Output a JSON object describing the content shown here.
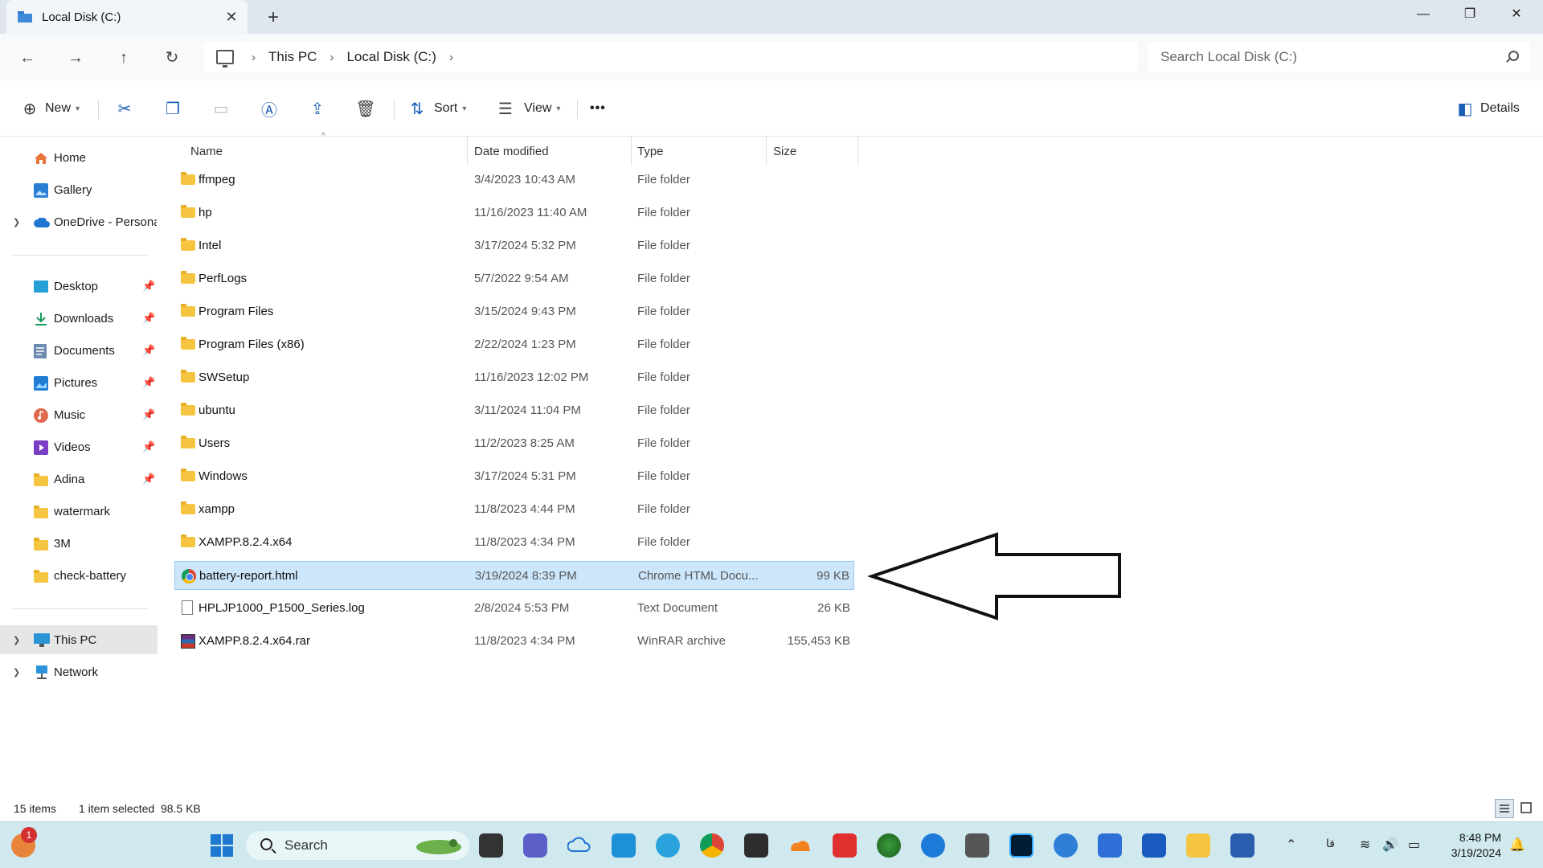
{
  "window": {
    "tab_title": "Local Disk (C:)",
    "tab_close": "✕",
    "new_tab": "+",
    "minimize": "—",
    "restore": "❐",
    "close": "✕"
  },
  "navigation": {
    "back": "←",
    "forward": "→",
    "up": "↑",
    "refresh": "↻",
    "breadcrumb": [
      "This PC",
      "Local Disk (C:)"
    ],
    "breadcrumb_sep": "›",
    "search_placeholder": "Search Local Disk (C:)"
  },
  "toolbar": {
    "new_label": "New",
    "sort_label": "Sort",
    "view_label": "View",
    "more_label": "•••",
    "details_label": "Details",
    "icons": {
      "new": "plus-circle-icon",
      "cut": "scissors-icon",
      "copy": "copy-icon",
      "paste": "paste-icon",
      "rename": "rename-icon",
      "share": "share-icon",
      "delete": "trash-icon"
    }
  },
  "sidebar": {
    "top_items": [
      {
        "label": "Home",
        "icon": "home-icon"
      },
      {
        "label": "Gallery",
        "icon": "gallery-icon"
      },
      {
        "label": "OneDrive - Persona",
        "icon": "cloud-icon"
      }
    ],
    "quick_access": [
      {
        "label": "Desktop",
        "icon": "desktop-icon",
        "pinned": true
      },
      {
        "label": "Downloads",
        "icon": "download-icon",
        "pinned": true
      },
      {
        "label": "Documents",
        "icon": "documents-icon",
        "pinned": true
      },
      {
        "label": "Pictures",
        "icon": "pictures-icon",
        "pinned": true
      },
      {
        "label": "Music",
        "icon": "music-icon",
        "pinned": true
      },
      {
        "label": "Videos",
        "icon": "videos-icon",
        "pinned": true
      },
      {
        "label": "Adina",
        "icon": "folder-icon",
        "pinned": true
      },
      {
        "label": "watermark",
        "icon": "folder-icon",
        "pinned": false
      },
      {
        "label": "3M",
        "icon": "folder-icon",
        "pinned": false
      },
      {
        "label": "check-battery",
        "icon": "folder-icon",
        "pinned": false
      }
    ],
    "bottom_items": [
      {
        "label": "This PC",
        "icon": "pc-icon",
        "selected": true
      },
      {
        "label": "Network",
        "icon": "network-icon",
        "selected": false
      }
    ]
  },
  "filelist": {
    "columns": [
      "Name",
      "Date modified",
      "Type",
      "Size"
    ],
    "rows": [
      {
        "name": "ffmpeg",
        "date": "3/4/2023 10:43 AM",
        "type": "File folder",
        "size": "",
        "kind": "folder"
      },
      {
        "name": "hp",
        "date": "11/16/2023 11:40 AM",
        "type": "File folder",
        "size": "",
        "kind": "folder"
      },
      {
        "name": "Intel",
        "date": "3/17/2024 5:32 PM",
        "type": "File folder",
        "size": "",
        "kind": "folder"
      },
      {
        "name": "PerfLogs",
        "date": "5/7/2022 9:54 AM",
        "type": "File folder",
        "size": "",
        "kind": "folder"
      },
      {
        "name": "Program Files",
        "date": "3/15/2024 9:43 PM",
        "type": "File folder",
        "size": "",
        "kind": "folder"
      },
      {
        "name": "Program Files (x86)",
        "date": "2/22/2024 1:23 PM",
        "type": "File folder",
        "size": "",
        "kind": "folder"
      },
      {
        "name": "SWSetup",
        "date": "11/16/2023 12:02 PM",
        "type": "File folder",
        "size": "",
        "kind": "folder"
      },
      {
        "name": "ubuntu",
        "date": "3/11/2024 11:04 PM",
        "type": "File folder",
        "size": "",
        "kind": "folder"
      },
      {
        "name": "Users",
        "date": "11/2/2023 8:25 AM",
        "type": "File folder",
        "size": "",
        "kind": "folder"
      },
      {
        "name": "Windows",
        "date": "3/17/2024 5:31 PM",
        "type": "File folder",
        "size": "",
        "kind": "folder"
      },
      {
        "name": "xampp",
        "date": "11/8/2023 4:44 PM",
        "type": "File folder",
        "size": "",
        "kind": "folder"
      },
      {
        "name": "XAMPP.8.2.4.x64",
        "date": "11/8/2023 4:34 PM",
        "type": "File folder",
        "size": "",
        "kind": "folder"
      },
      {
        "name": "battery-report.html",
        "date": "3/19/2024 8:39 PM",
        "type": "Chrome HTML Docu...",
        "size": "99 KB",
        "kind": "chrome",
        "selected": true
      },
      {
        "name": "HPLJP1000_P1500_Series.log",
        "date": "2/8/2024 5:53 PM",
        "type": "Text Document",
        "size": "26 KB",
        "kind": "text"
      },
      {
        "name": "XAMPP.8.2.4.x64.rar",
        "date": "11/8/2023 4:34 PM",
        "type": "WinRAR archive",
        "size": "155,453 KB",
        "kind": "rar"
      }
    ]
  },
  "status": {
    "count": "15 items",
    "selection": "1 item selected  98.5 KB"
  },
  "taskbar": {
    "search_label": "Search",
    "notification_badge": "1",
    "time": "8:48 PM",
    "date": "3/19/2024",
    "tray_lang": "فا",
    "colors": {
      "background": "#cfe9ef",
      "selection": "#cce6fb",
      "folder": "#f5c542"
    }
  }
}
